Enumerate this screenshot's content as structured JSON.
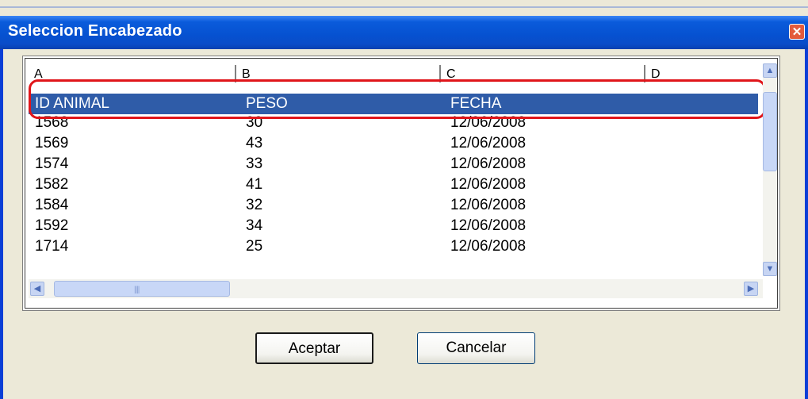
{
  "window": {
    "title": "Seleccion Encabezado",
    "close_glyph": "✕"
  },
  "grid": {
    "columns": [
      "A",
      "B",
      "C",
      "D"
    ],
    "selected_row": [
      "ID ANIMAL",
      "PESO",
      "FECHA"
    ],
    "rows": [
      [
        "1568",
        "30",
        "12/06/2008"
      ],
      [
        "1569",
        "43",
        "12/06/2008"
      ],
      [
        "1574",
        "33",
        "12/06/2008"
      ],
      [
        "1582",
        "41",
        "12/06/2008"
      ],
      [
        "1584",
        "32",
        "12/06/2008"
      ],
      [
        "1592",
        "34",
        "12/06/2008"
      ],
      [
        "1714",
        "25",
        "12/06/2008"
      ]
    ]
  },
  "buttons": {
    "accept": "Aceptar",
    "cancel": "Cancelar"
  },
  "colors": {
    "title_bar": "#0651d0",
    "selection": "#2f5ca8",
    "highlight_outline": "#e0151a"
  },
  "icons": {
    "close": "close-icon",
    "scroll_up": "arrow-up-icon",
    "scroll_down": "arrow-down-icon",
    "scroll_left": "arrow-left-icon",
    "scroll_right": "arrow-right-icon"
  }
}
